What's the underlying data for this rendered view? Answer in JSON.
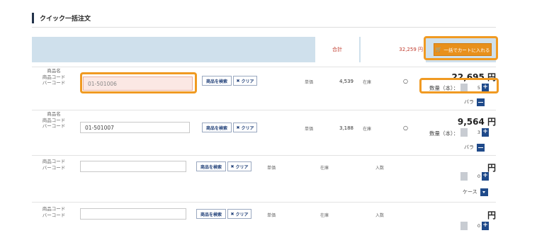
{
  "header": {
    "title": "クイック一括注文"
  },
  "summary": {
    "total_label": "合計",
    "total_value": "32,259 円",
    "add_all_to_cart": "一括でカートに入れる"
  },
  "labels": {
    "name": "商品名",
    "code": "商品コード",
    "barcode": "バーコード",
    "search": "商品を検索",
    "clear": "クリア",
    "unit_price": "単価",
    "stock": "在庫",
    "pack_qty": "入数",
    "quantity": "数量（本）：",
    "yen": "円"
  },
  "rows": [
    {
      "code": "01-501006",
      "unit_price": "4,539",
      "stock": "○",
      "price": "22,695 円",
      "qty": "5",
      "unit": "バラ"
    },
    {
      "code": "01-501007",
      "unit_price": "3,188",
      "stock": "○",
      "price": "9,564 円",
      "qty": "3",
      "unit": "バラ"
    },
    {
      "code": "",
      "price": "円",
      "qty": "0",
      "unit": "ケース"
    },
    {
      "code": "",
      "price": "円",
      "qty": "0"
    }
  ],
  "colors": {
    "accent_orange": "#e8901c",
    "navy": "#1f4a8a",
    "total_red": "#c0392b",
    "highlight": "#f09a22"
  }
}
